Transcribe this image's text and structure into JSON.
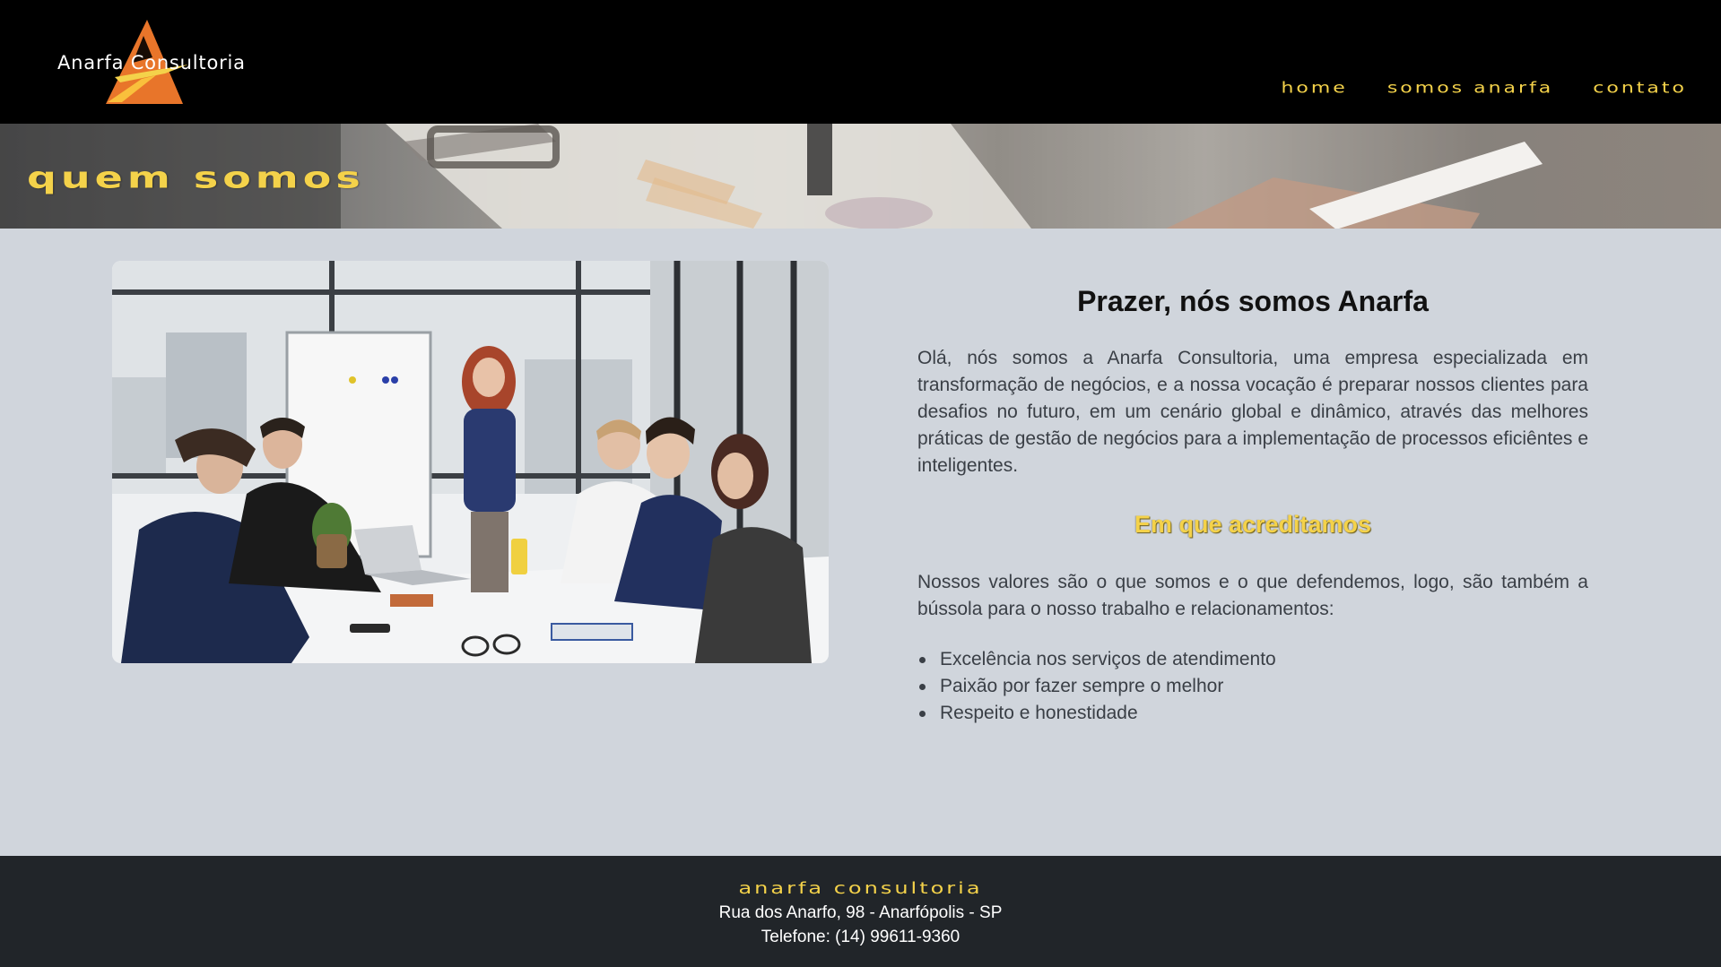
{
  "header": {
    "logo_text": "Anarfa Consultoria",
    "nav": [
      {
        "label": "Home"
      },
      {
        "label": "Somos Anarfa"
      },
      {
        "label": "Contato"
      }
    ]
  },
  "banner": {
    "title": "Quem Somos"
  },
  "main": {
    "photo_icon": "team-meeting-photo",
    "heading": "Prazer, nós somos Anarfa",
    "intro": "Olá, nós somos a Anarfa Consultoria, uma empresa especializada em transformação de negócios, e a nossa vocação é preparar nossos clientes para desafios no futuro, em um cenário global e dinâmico, através das melhores práticas de gestão de negócios para a implementação de processos eficiêntes e inteligentes.",
    "subheading": "Em que acreditamos",
    "values_intro": "Nossos valores são o que somos e o que defendemos, logo, são também a bússola para o nosso trabalho e relacionamentos:",
    "values": [
      "Excelência nos serviços de atendimento",
      "Paixão por fazer sempre o melhor",
      "Respeito e honestidade"
    ]
  },
  "footer": {
    "brand": "Anarfa Consultoria",
    "address": "Rua dos Anarfo, 98 - Anarfópolis - SP",
    "phone": "Telefone: (14) 99611-9360"
  },
  "colors": {
    "accent": "#f4d24a",
    "header_bg": "#000000",
    "page_bg": "#d0d5dc",
    "footer_bg": "#212529",
    "logo_orange": "#e8752a"
  }
}
